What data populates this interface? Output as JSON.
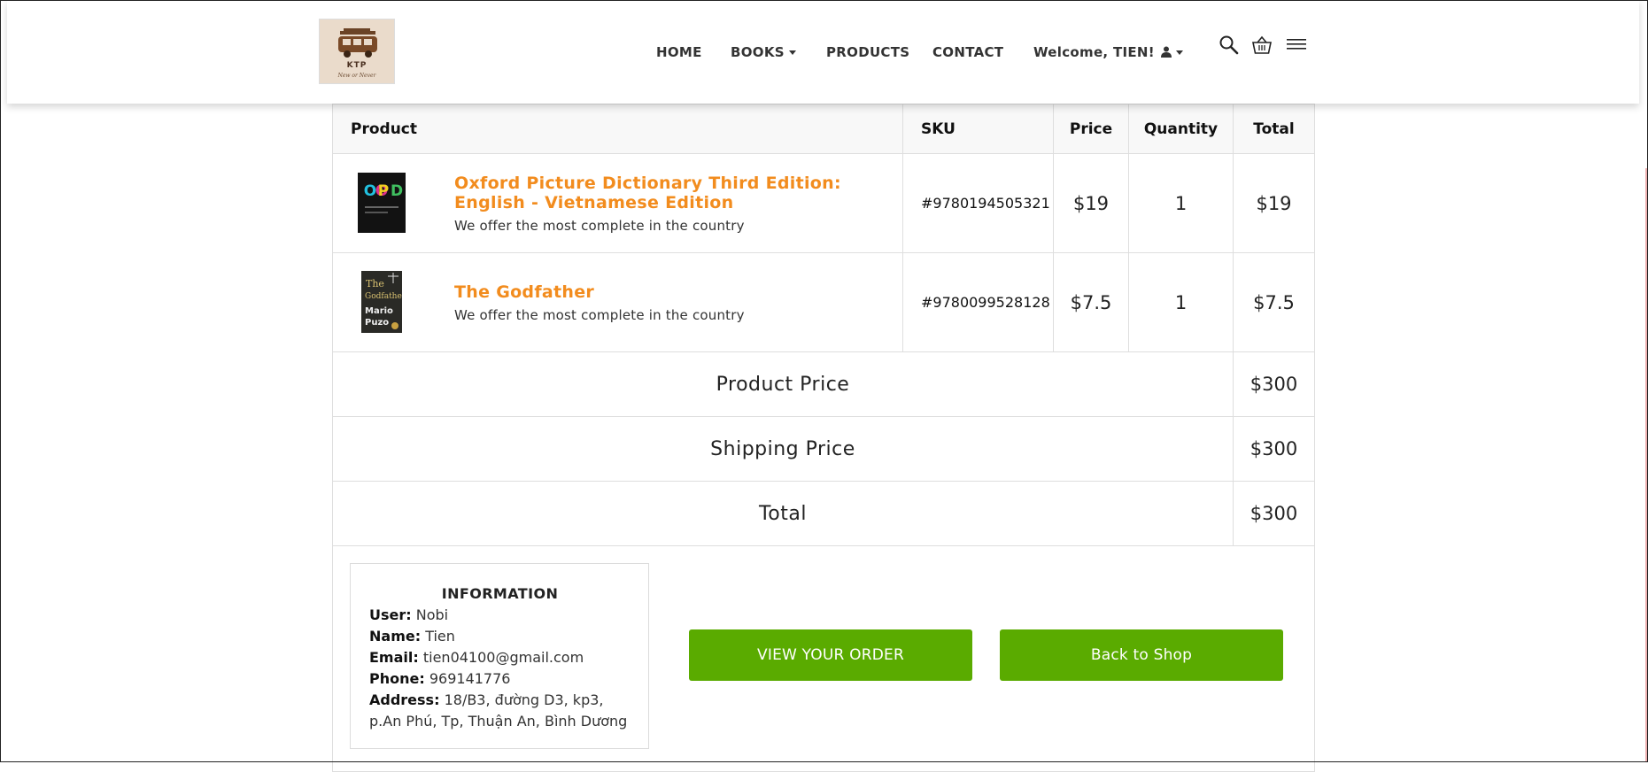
{
  "header": {
    "logo": {
      "brand": "KTP",
      "tagline": "New or Never"
    },
    "nav": [
      {
        "label": "HOME",
        "dropdown": false
      },
      {
        "label": "BOOKS",
        "dropdown": true
      },
      {
        "label": "PRODUCTS",
        "dropdown": false
      },
      {
        "label": "CONTACT",
        "dropdown": false
      },
      {
        "label": "Welcome, TIEN!",
        "dropdown": true,
        "icon": "user-icon"
      }
    ],
    "icons": [
      "search-icon",
      "basket-icon",
      "menu-icon"
    ]
  },
  "table": {
    "columns": [
      "Product",
      "SKU",
      "Price",
      "Quantity",
      "Total"
    ],
    "items": [
      {
        "title": "Oxford Picture Dictionary Third Edition: English - Vietnamese Edition",
        "description": "We offer the most complete in the country",
        "sku": "#9780194505321",
        "price": "$19",
        "quantity": "1",
        "total": "$19",
        "cover_text": "OPD"
      },
      {
        "title": "The Godfather",
        "description": "We offer the most complete in the country",
        "sku": "#9780099528128",
        "price": "$7.5",
        "quantity": "1",
        "total": "$7.5",
        "cover_text": "The Godfather Mario Puzo"
      }
    ],
    "summary": [
      {
        "label": "Product Price",
        "value": "$300"
      },
      {
        "label": "Shipping Price",
        "value": "$300"
      },
      {
        "label": "Total",
        "value": "$300"
      }
    ]
  },
  "information": {
    "heading": "INFORMATION",
    "fields": [
      {
        "label": "User:",
        "value": "Nobi"
      },
      {
        "label": "Name:",
        "value": "Tien"
      },
      {
        "label": "Email:",
        "value": "tien04100@gmail.com"
      },
      {
        "label": "Phone:",
        "value": "969141776"
      },
      {
        "label": "Address:",
        "value": "18/B3, đường D3, kp3, p.An Phú, Tp, Thuận An, Bình Dương"
      }
    ]
  },
  "buttons": {
    "view_order": "VIEW YOUR ORDER",
    "back_to_shop": "Back to Shop"
  },
  "colors": {
    "accent_orange": "#f28c1e",
    "button_green": "#5aab00",
    "header_bg": "#f8f8f8"
  }
}
